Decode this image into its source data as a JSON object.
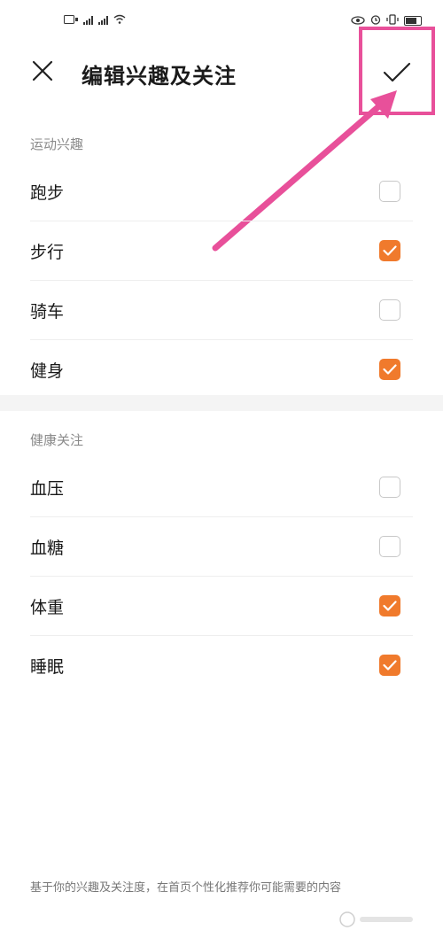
{
  "status_bar": {
    "left_icons": [
      "sim-card-icon",
      "signal-icon",
      "signal-icon",
      "wifi-icon"
    ],
    "right_icons": [
      "eye-icon",
      "alarm-icon",
      "vibrate-icon",
      "battery-icon"
    ]
  },
  "header": {
    "title": "编辑兴趣及关注",
    "close_icon": "close-icon",
    "confirm_icon": "check-icon"
  },
  "sections": [
    {
      "label": "运动兴趣",
      "items": [
        {
          "label": "跑步",
          "checked": false
        },
        {
          "label": "步行",
          "checked": true
        },
        {
          "label": "骑车",
          "checked": false
        },
        {
          "label": "健身",
          "checked": true
        }
      ]
    },
    {
      "label": "健康关注",
      "items": [
        {
          "label": "血压",
          "checked": false
        },
        {
          "label": "血糖",
          "checked": false
        },
        {
          "label": "体重",
          "checked": true
        },
        {
          "label": "睡眠",
          "checked": true
        }
      ]
    }
  ],
  "footer": {
    "note": "基于你的兴趣及关注度，在首页个性化推荐你可能需要的内容"
  },
  "colors": {
    "accent": "#f07a2c",
    "annotation": "#e8509a"
  }
}
